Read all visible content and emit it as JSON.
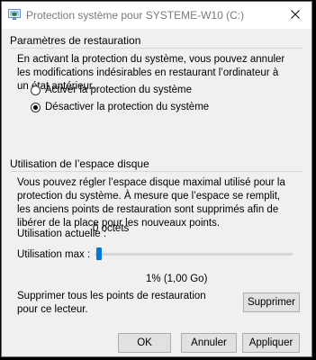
{
  "window": {
    "title": "Protection système pour SYSTEME-W10 (C:)"
  },
  "restore_settings": {
    "group_title": "Paramètres de restauration",
    "description": "En activant la protection du système, vous pouvez annuler les modifications indésirables en restaurant l’ordinateur à un état antérieur.",
    "options": [
      {
        "label": "Activer la protection du système",
        "selected": false
      },
      {
        "label": "Désactiver la protection du système",
        "selected": true
      }
    ]
  },
  "disk_usage": {
    "group_title": "Utilisation de l’espace disque",
    "description": "Vous pouvez régler l’espace disque maximal utilisé pour la protection du système. À mesure que l’espace se remplit, les anciens points de restauration sont supprimés afin de libérer de la place pour les nouveaux points.",
    "current_usage_label": "Utilisation actuelle :",
    "current_usage_value": "0 octets",
    "max_usage_label": "Utilisation max :",
    "max_usage_percent": 1,
    "max_usage_value": "1% (1,00 Go)",
    "delete_text": "Supprimer tous les points de restauration pour ce lecteur.",
    "delete_button": "Supprimer"
  },
  "footer": {
    "ok_label": "OK",
    "cancel_label": "Annuler",
    "apply_label": "Appliquer"
  },
  "colors": {
    "accent": "#0078d7",
    "window_bg": "#f0f0f0",
    "title_text": "#7a7a7a"
  },
  "icons": {
    "title": "system-protection-icon",
    "close": "close-icon"
  }
}
